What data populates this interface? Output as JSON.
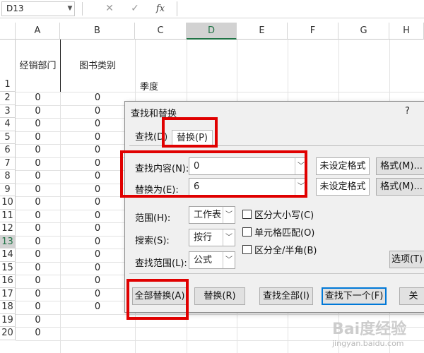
{
  "formula_bar": {
    "name_box": "D13",
    "name_box_dropdown_glyph": "▼",
    "cancel_glyph": "✕",
    "enter_glyph": "✓",
    "fx_glyph": "fx",
    "formula": ""
  },
  "columns": [
    "A",
    "B",
    "C",
    "D",
    "E",
    "F",
    "G",
    "H"
  ],
  "rows": [
    "1",
    "2",
    "3",
    "4",
    "5",
    "6",
    "7",
    "8",
    "9",
    "10",
    "11",
    "12",
    "13",
    "14",
    "15",
    "16",
    "17",
    "18",
    "19",
    "20"
  ],
  "row1": {
    "a": "经销部门",
    "b": "图书类别",
    "c": "季度"
  },
  "zero": "0",
  "dialog": {
    "title": "查找和替换",
    "help": "?",
    "tab_find": "查找(D)",
    "tab_replace": "替换(P)",
    "find_label": "查找内容(N):",
    "find_value": "0",
    "replace_label": "替换为(E):",
    "replace_value": "6",
    "no_format_1": "未设定格式",
    "no_format_2": "未设定格式",
    "format_btn_1": "格式(M)...",
    "format_btn_2": "格式(M)...",
    "scope_label": "范围(H):",
    "scope_value": "工作表",
    "search_label": "搜索(S):",
    "search_value": "按行",
    "lookin_label": "查找范围(L):",
    "lookin_value": "公式",
    "match_case": "区分大小写(C)",
    "match_entire": "单元格匹配(O)",
    "match_width": "区分全/半角(B)",
    "options": "选项(T)",
    "replace_all": "全部替换(A)",
    "replace": "替换(R)",
    "find_all": "查找全部(I)",
    "find_next": "查找下一个(F)",
    "close": "关"
  },
  "watermark": {
    "text": "Bai度经验",
    "url": "jingyan.baidu.com"
  },
  "colors": {
    "highlight": "#e00000",
    "excel_green": "#217346",
    "focus": "#0078d7"
  }
}
